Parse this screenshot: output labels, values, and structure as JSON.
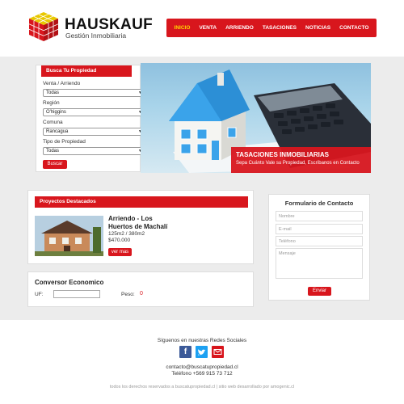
{
  "brand": {
    "name": "HAUSKAUF",
    "tagline": "Gestión Inmobiliaria"
  },
  "nav": {
    "items": [
      {
        "label": "INICIO",
        "active": true
      },
      {
        "label": "VENTA",
        "active": false
      },
      {
        "label": "ARRIENDO",
        "active": false
      },
      {
        "label": "TASACIONES",
        "active": false
      },
      {
        "label": "NOTICIAS",
        "active": false
      },
      {
        "label": "CONTACTO",
        "active": false
      }
    ]
  },
  "search": {
    "title": "Busca Tu Propiedad",
    "operation_label": "Venta / Arriendo",
    "operation_value": "Todas",
    "region_label": "Región",
    "region_value": "O'higgins",
    "comuna_label": "Comuna",
    "comuna_value": "Rancagua",
    "tipo_label": "Tipo de Propiedad",
    "tipo_value": "Todas",
    "button": "Buscar"
  },
  "hero": {
    "title": "TASACIONES INMOBILIARIAS",
    "subtitle": "Sepa Cuánto Vale su Propiedad, Escríbanos en Contacto"
  },
  "projects": {
    "title": "Proyectos Destacados",
    "item": {
      "title": "Arriendo - Los Huertos de Machalí",
      "area": "125m2 / 380m2",
      "price": "$470.000",
      "button": "ver mas"
    }
  },
  "converter": {
    "title": "Conversor Economico",
    "uf_label": "UF:",
    "peso_label": "Peso:",
    "peso_value": "0"
  },
  "contact": {
    "title": "Formulario de Contacto",
    "name_placeholder": "Nombre",
    "email_placeholder": "E-mail",
    "phone_placeholder": "Teléfono",
    "message_placeholder": "Mensaje",
    "button": "Enviar"
  },
  "footer": {
    "social_text": "Síguenos en nuestras Redes Sociales",
    "email": "contacto@buscatupropiedad.cl",
    "phone": "Teléfono +569 915 73 712",
    "copyright": "todos los derechos reservados a buscatupropiedad.cl  |  sitio web desarrollado por amogenic.cl"
  },
  "colors": {
    "brand_red": "#d8161d",
    "active_nav": "#ffd400",
    "facebook": "#3b5998",
    "twitter": "#1da1f2",
    "mail": "#d8161d"
  }
}
